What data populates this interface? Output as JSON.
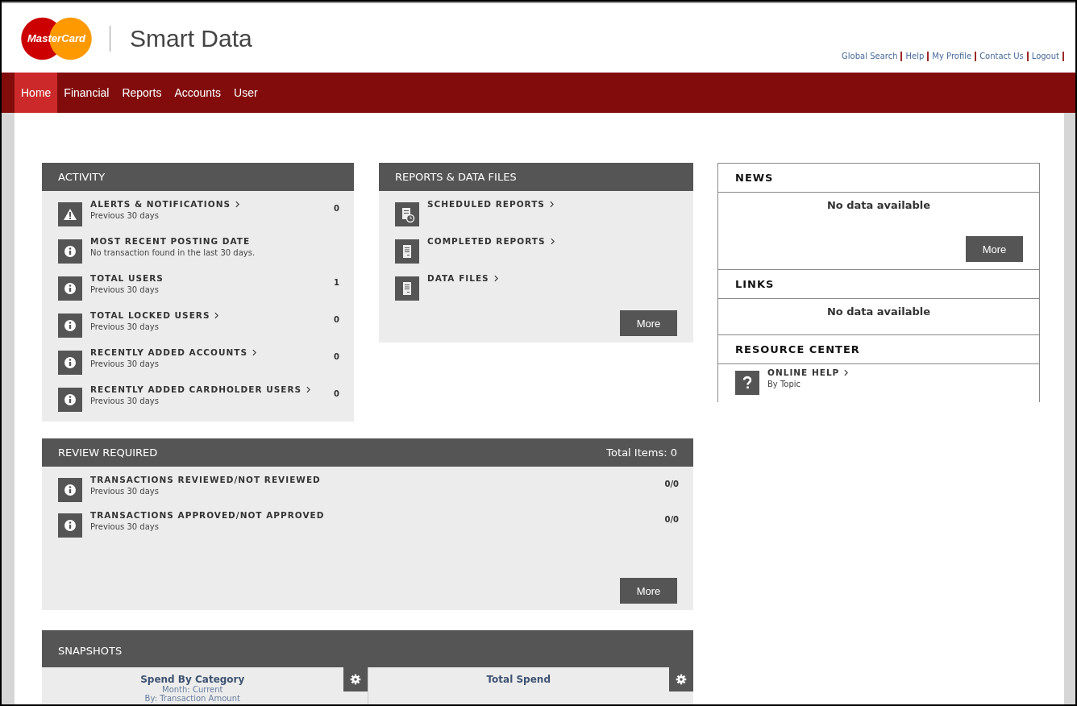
{
  "logo": {
    "text": "MasterCard"
  },
  "app_title": "Smart Data",
  "header_links": [
    "Global Search",
    "Help",
    "My Profile",
    "Contact Us",
    "Logout"
  ],
  "nav": [
    {
      "label": "Home",
      "selected": true
    },
    {
      "label": "Financial",
      "selected": false
    },
    {
      "label": "Reports",
      "selected": false
    },
    {
      "label": "Accounts",
      "selected": false
    },
    {
      "label": "User",
      "selected": false
    }
  ],
  "activity": {
    "title": "ACTIVITY",
    "items": [
      {
        "kind": "warning",
        "title": "ALERTS & NOTIFICATIONS",
        "linked": true,
        "subtitle": "Previous 30 days",
        "value": "0"
      },
      {
        "kind": "info",
        "title": "MOST RECENT POSTING DATE",
        "linked": false,
        "subtitle": "No transaction found in the last 30 days."
      },
      {
        "kind": "info",
        "title": "TOTAL USERS",
        "linked": false,
        "subtitle": "Previous 30 days",
        "value": "1"
      },
      {
        "kind": "info",
        "title": "TOTAL LOCKED USERS",
        "linked": true,
        "subtitle": "Previous 30 days",
        "value": "0"
      },
      {
        "kind": "info",
        "title": "RECENTLY ADDED ACCOUNTS",
        "linked": true,
        "subtitle": "Previous 30 days",
        "value": "0"
      },
      {
        "kind": "info",
        "title": "RECENTLY ADDED CARDHOLDER USERS",
        "linked": true,
        "subtitle": "Previous 30 days",
        "value": "0"
      }
    ]
  },
  "reports": {
    "title": "REPORTS & DATA FILES",
    "items": [
      {
        "kind": "schedule",
        "title": "SCHEDULED REPORTS",
        "linked": true
      },
      {
        "kind": "document",
        "title": "COMPLETED REPORTS",
        "linked": true
      },
      {
        "kind": "document",
        "title": "DATA FILES",
        "linked": true
      }
    ],
    "button": "More"
  },
  "review": {
    "title": "REVIEW REQUIRED",
    "total": "Total Items: 0",
    "items": [
      {
        "kind": "info",
        "title": "TRANSACTIONS REVIEWED/NOT REVIEWED",
        "linked": false,
        "subtitle": "Previous 30 days",
        "value": "0/0"
      },
      {
        "kind": "info",
        "title": "TRANSACTIONS APPROVED/NOT APPROVED",
        "linked": false,
        "subtitle": "Previous 30 days",
        "value": "0/0"
      }
    ],
    "button": "More"
  },
  "snapshots": {
    "title": "SNAPSHOTS",
    "cards": [
      {
        "title": "Spend By Category",
        "lines": [
          "Month: Current",
          "By: Transaction Amount"
        ]
      },
      {
        "title": "Total Spend"
      }
    ]
  },
  "news": {
    "title": "NEWS",
    "empty": "No data available",
    "button": "More"
  },
  "links": {
    "title": "LINKS",
    "empty": "No data available"
  },
  "resource_center": {
    "title": "RESOURCE CENTER",
    "items": [
      {
        "kind": "help",
        "title": "ONLINE HELP",
        "linked": true,
        "subtitle": "By Topic"
      }
    ]
  }
}
